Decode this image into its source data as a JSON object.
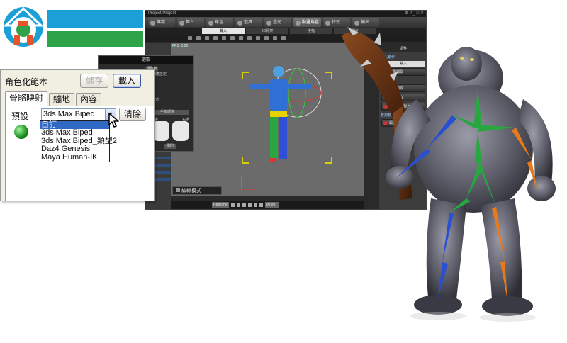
{
  "colors": {
    "logo_blue": "#1a9fd6",
    "logo_green": "#2ea34a",
    "selection_blue": "#316ac5",
    "bone_blue": "#2a4fd0",
    "bone_orange": "#e87a1a",
    "bone_green": "#28a640"
  },
  "logo": {
    "name": "company-logo",
    "icon": "house-gear-icon"
  },
  "app_window": {
    "title": "Project:Project",
    "tabs": [
      {
        "label": "專案",
        "active": false
      },
      {
        "label": "舞台",
        "active": false
      },
      {
        "label": "角色",
        "active": false
      },
      {
        "label": "道具",
        "active": false
      },
      {
        "label": "燈光",
        "active": false
      },
      {
        "label": "動畫角色",
        "active": true
      },
      {
        "label": "特效",
        "active": false
      },
      {
        "label": "輸出",
        "active": false
      }
    ],
    "subtabs": [
      {
        "label": "載入",
        "active": true
      },
      {
        "label": "3D骨架",
        "active": false
      },
      {
        "label": "手指",
        "active": false
      },
      {
        "label": "腳步",
        "active": false
      }
    ],
    "viewport": {
      "fps": "FPS: 0.00",
      "mode_label": "編輯模式"
    },
    "transport": {
      "play_label": "Realtime",
      "timecode": "00:00"
    },
    "hand_panel": {
      "title": "選取",
      "subtitle": "選取範圍",
      "rows": [
        "動作對應設定",
        "骨架",
        "方式",
        "主體",
        "骨骼方向",
        "群組",
        "對稱映射"
      ],
      "hand_title": "手指調整",
      "left_label": "左手",
      "right_label": "右手",
      "close_label": "關閉"
    },
    "right_panel": {
      "header": "調整",
      "section1": "載入動作",
      "select": "載入",
      "section2": "建立動作",
      "buttons": [
        "動態擷取",
        "動態擷取",
        "動畫擷取",
        "骨架對應製作",
        "編輯動作"
      ],
      "section3": "套用動作"
    }
  },
  "dialog": {
    "title": "角色化範本",
    "save_label": "儲存",
    "load_label": "載入",
    "tabs": [
      {
        "label": "骨骼映射",
        "active": true
      },
      {
        "label": "繃地",
        "active": false
      },
      {
        "label": "內容",
        "active": false
      }
    ],
    "preset_label": "預設",
    "preset_value": "3ds Max Biped",
    "clear_label": "清除",
    "dropdown_options": [
      {
        "label": "自訂",
        "selected": true
      },
      {
        "label": "3ds Max Biped",
        "selected": false
      },
      {
        "label": "3ds Max Biped_類型2",
        "selected": false
      },
      {
        "label": "Daz4 Genesis",
        "selected": false
      },
      {
        "label": "Maya Human-IK",
        "selected": false
      }
    ]
  },
  "character": {
    "name": "ogre-character",
    "weapon": "spiked-club"
  }
}
